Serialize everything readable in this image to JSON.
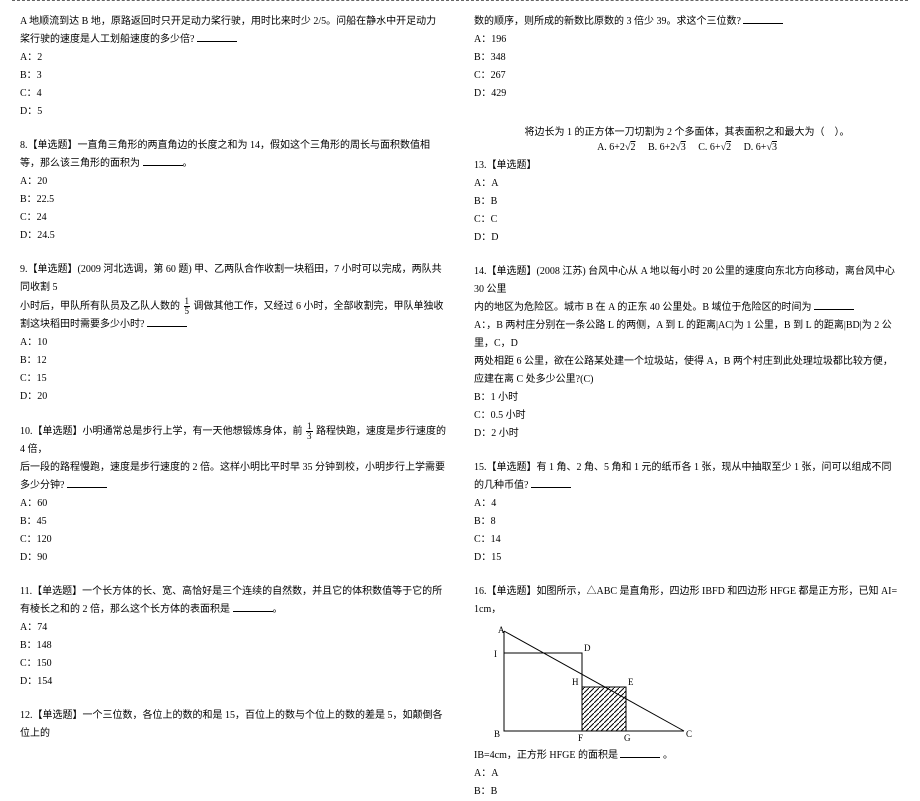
{
  "left": {
    "q7_tail": "A 地顺流到达 B 地，原路返回时只开足动力桨行驶，用时比来时少 2/5。问船在静水中开足动力桨行驶的速度是人工划船速度的多少倍?",
    "q7_opts": [
      "A：2",
      "B：3",
      "C：4",
      "D：5"
    ],
    "q8": "8.【单选题】一直角三角形的两直角边的长度之和为 14，假如这个三角形的周长与面积数值相等，那么该三角形的面积为",
    "q8_opts": [
      "A：20",
      "B：22.5",
      "C：24",
      "D：24.5"
    ],
    "q9_part1": "9.【单选题】(2009 河北选调，第 60 题) 甲、乙两队合作收割一块稻田，7 小时可以完成，两队共同收割 5",
    "q9_part2_pre": "小时后，甲队所有队员及乙队人数的",
    "q9_frac_num": "1",
    "q9_frac_den": "5",
    "q9_part2_post": " 调做其他工作，又经过 6 小时，全部收割完，甲队单独收割这块稻田时需要多少小时?",
    "q9_opts": [
      "A：10",
      "B：12",
      "C：15",
      "D：20"
    ],
    "q10_pre": "10.【单选题】小明通常总是步行上学，有一天他想锻炼身体，前",
    "q10_fnum": "1",
    "q10_fden": "3",
    "q10_mid": " 路程快跑，速度是步行速度的 4 倍，",
    "q10_part2": "后一段的路程慢跑，速度是步行速度的 2 倍。这样小明比平时早 35 分钟到校，小明步行上学需要多少分钟?",
    "q10_opts": [
      "A：60",
      "B：45",
      "C：120",
      "D：90"
    ],
    "q11": "11.【单选题】一个长方体的长、宽、高恰好是三个连续的自然数，并且它的体积数值等于它的所有棱长之和的 2 倍，那么这个长方体的表面积是",
    "q11_opts": [
      "A：74",
      "B：148",
      "C：150",
      "D：154"
    ],
    "q12": "12.【单选题】一个三位数，各位上的数的和是 15，百位上的数与个位上的数的差是 5，如颠倒各位上的"
  },
  "right": {
    "q12_tail": "数的顺序，则所成的新数比原数的 3 倍少 39。求这个三位数?",
    "q12_opts": [
      "A：196",
      "B：348",
      "C：267",
      "D：429"
    ],
    "q13_stem": "将边长为 1 的正方体一刀切割为 2 个多面体，其表面积之和最大为（　）。",
    "q13_A_pre": "A. 6+2",
    "q13_B_pre": "B. 6+2",
    "q13_C_pre": "C. 6+",
    "q13_D_pre": "D. 6+",
    "q13_sqrt2": "2",
    "q13_sqrt3": "3",
    "q13_label": "13.【单选题】",
    "q13_opts": [
      "A：A",
      "B：B",
      "C：C",
      "D：D"
    ],
    "q14_l1": "14.【单选题】(2008 江苏) 台风中心从 A 地以每小时 20 公里的速度向东北方向移动，离台风中心 30 公里",
    "q14_l2": "内的地区为危险区。城市 B 在 A 的正东 40 公里处。B 域位于危险区的时间为",
    "q14_l3": "A：，B 两村庄分别在一条公路 L 的两侧，A 到 L 的距离|AC|为 1 公里，B 到 L 的距离|BD|为 2 公里，C，D",
    "q14_l4": "两处相距 6 公里，欲在公路某处建一个垃圾站，使得 A，B 两个村庄到此处理垃圾都比较方便，应建在离 C 处多少公里?(C)",
    "q14_opts": [
      "B：1 小时",
      "C：0.5 小时",
      "D：2 小时"
    ],
    "q15": "15.【单选题】有 1 角、2 角、5 角和 1 元的纸币各 1 张，现从中抽取至少 1 张，问可以组成不同的几种币值?",
    "q15_opts": [
      "A：4",
      "B：8",
      "C：14",
      "D：15"
    ],
    "q16_pre": "16.【单选题】如图所示，△ABC 是直角形，四边形 IBFD 和四边形 HFGE 都是正方形，已知 AI=1cm，",
    "q16_post_pre": "IB=4cm，正方形 HFGE 的面积是",
    "q16_post_suf": "。",
    "q16_opts": [
      "A：A",
      "B：B"
    ],
    "diagram_labels": {
      "A": "A",
      "I": "I",
      "B": "B",
      "D": "D",
      "H": "H",
      "E": "E",
      "F": "F",
      "G": "G",
      "C": "C"
    }
  }
}
